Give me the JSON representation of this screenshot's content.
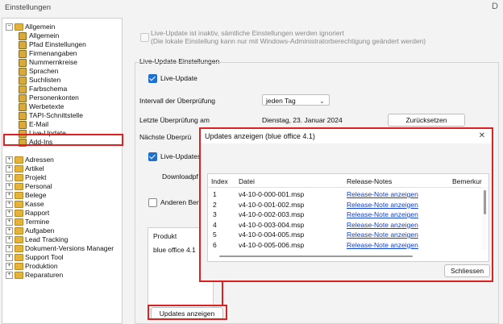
{
  "window": {
    "title": "Einstellungen",
    "close_glyph": "D"
  },
  "tree": {
    "root": "Allgemein",
    "children": [
      "Allgemein",
      "Pfad Einstellungen",
      "Firmenangaben",
      "Nummernkreise",
      "Sprachen",
      "Suchlisten",
      "Farbschema",
      "Personenkonten",
      "Werbetexte",
      "TAPI-Schnittstelle",
      "E-Mail",
      "Live-Update",
      "Add-Ins"
    ],
    "selected": "Live-Update",
    "top_level": [
      "Adressen",
      "Artikel",
      "Projekt",
      "Personal",
      "Belege",
      "Kasse",
      "Rapport",
      "Termine",
      "Aufgaben",
      "Lead Tracking",
      "Dokument-Versions Manager",
      "Support Tool",
      "Produktion",
      "Reparaturen"
    ]
  },
  "panel": {
    "inactive_note_line1": "Live-Update ist inaktiv, sämtliche Einstellungen werden ignoriert",
    "inactive_note_line2": "(Die lokale Einstellung kann nur mit Windows-Administratorberechtigung geändert werden)",
    "group_title": "Live-Update Einstellungen",
    "live_update_label": "Live-Update",
    "interval_label": "Intervall der Überprüfung",
    "interval_value": "jeden Tag",
    "last_check_label": "Letzte Überprüfung am",
    "last_check_value": "Dienstag, 23. Januar 2024",
    "reset_button": "Zurücksetzen",
    "next_check_label": "Nächste Überprü",
    "updates_label": "Live-Updates",
    "download_label": "Downloadpf",
    "other_label": "Anderen Ber",
    "product_header": "Produkt",
    "product_value": "blue office 4.1",
    "show_updates_button": "Updates anzeigen"
  },
  "dialog": {
    "title": "Updates anzeigen (blue office 4.1)",
    "close_glyph": "✕",
    "columns": [
      "Index",
      "Datei",
      "Release-Notes",
      "Bemerkur"
    ],
    "rows": [
      {
        "index": "1",
        "file": "v4-10-0-000-001.msp",
        "notes": "Release-Note anzeigen"
      },
      {
        "index": "2",
        "file": "v4-10-0-001-002.msp",
        "notes": "Release-Note anzeigen"
      },
      {
        "index": "3",
        "file": "v4-10-0-002-003.msp",
        "notes": "Release-Note anzeigen"
      },
      {
        "index": "4",
        "file": "v4-10-0-003-004.msp",
        "notes": "Release-Note anzeigen"
      },
      {
        "index": "5",
        "file": "v4-10-0-004-005.msp",
        "notes": "Release-Note anzeigen"
      },
      {
        "index": "6",
        "file": "v4-10-0-005-006.msp",
        "notes": "Release-Note anzeigen"
      }
    ],
    "close_button": "Schliessen"
  },
  "colors": {
    "highlight": "#e02020",
    "checkbox": "#1f6fd1",
    "link": "#1040d0"
  }
}
